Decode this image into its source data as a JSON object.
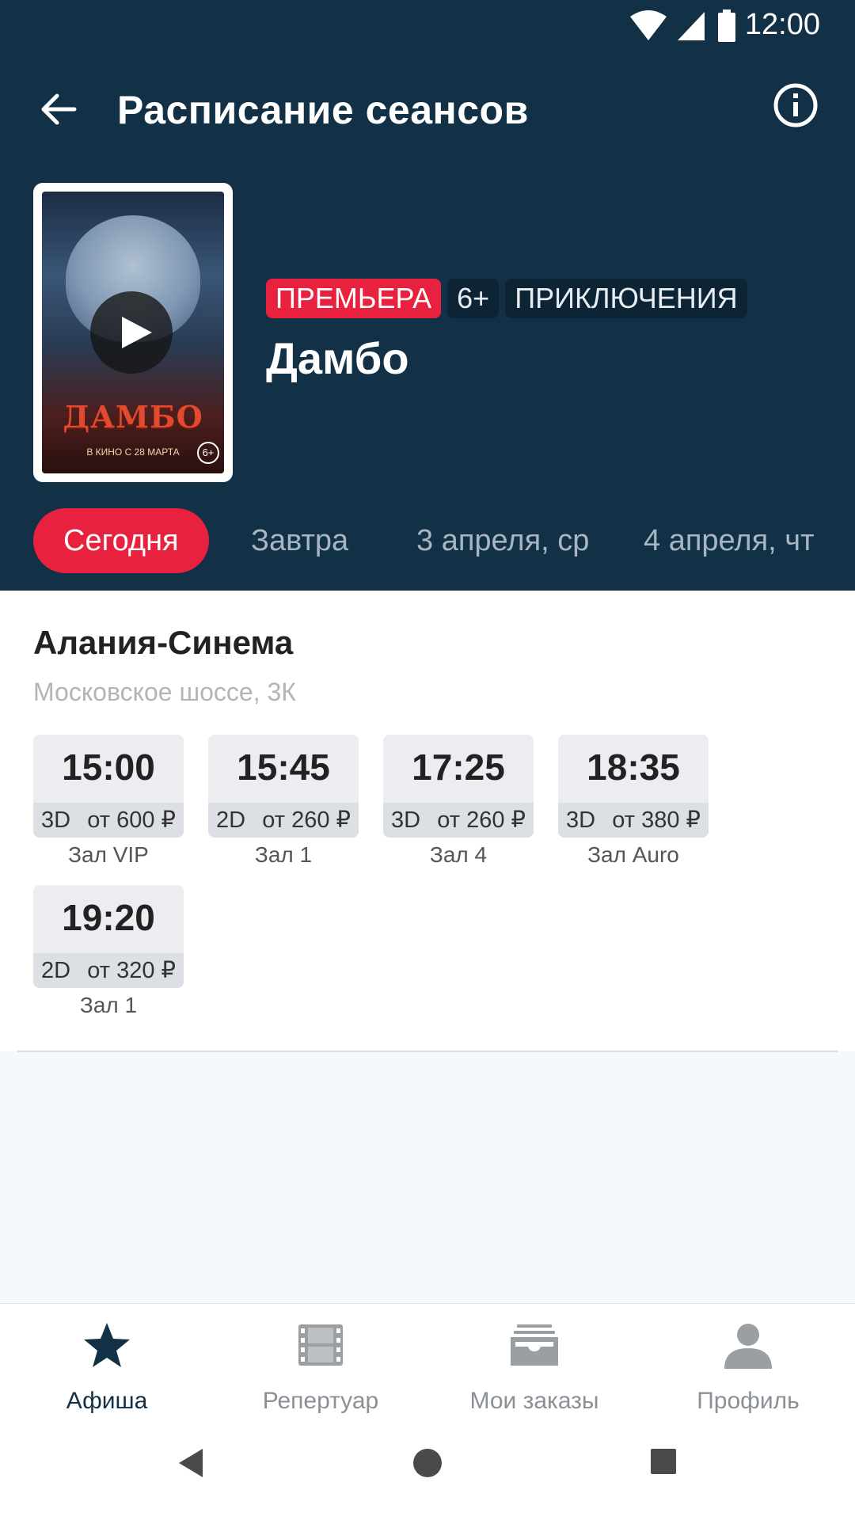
{
  "status_bar": {
    "time": "12:00"
  },
  "toolbar": {
    "title": "Расписание сеансов"
  },
  "movie": {
    "poster_title": "ДАМБО",
    "poster_subtitle": "В КИНО С 28 МАРТА",
    "poster_rating": "6+",
    "tags": {
      "premiere": "ПРЕМЬЕРА",
      "age": "6+",
      "genre": "ПРИКЛЮЧЕНИЯ"
    },
    "title": "Дамбо"
  },
  "date_tabs": [
    {
      "label": "Сегодня"
    },
    {
      "label": "Завтра"
    },
    {
      "label": "3 апреля, ср"
    },
    {
      "label": "4 апреля, чт"
    }
  ],
  "cinema": {
    "name": "Алания-Синема",
    "address": "Московское шоссе, 3К"
  },
  "sessions": [
    {
      "time": "15:00",
      "format": "3D",
      "price": "от 600 ₽",
      "hall": "Зал VIP"
    },
    {
      "time": "15:45",
      "format": "2D",
      "price": "от 260 ₽",
      "hall": "Зал 1"
    },
    {
      "time": "17:25",
      "format": "3D",
      "price": "от 260 ₽",
      "hall": "Зал 4"
    },
    {
      "time": "18:35",
      "format": "3D",
      "price": "от 380 ₽",
      "hall": "Зал Auro"
    },
    {
      "time": "19:20",
      "format": "2D",
      "price": "от 320 ₽",
      "hall": "Зал 1"
    }
  ],
  "bottom_nav": [
    {
      "label": "Афиша",
      "icon": "star-icon"
    },
    {
      "label": "Репертуар",
      "icon": "film-icon"
    },
    {
      "label": "Мои заказы",
      "icon": "orders-icon"
    },
    {
      "label": "Профиль",
      "icon": "profile-icon"
    }
  ],
  "colors": {
    "header_bg": "#123046",
    "accent": "#e8213f",
    "tab_inactive": "#a7b6c2"
  }
}
